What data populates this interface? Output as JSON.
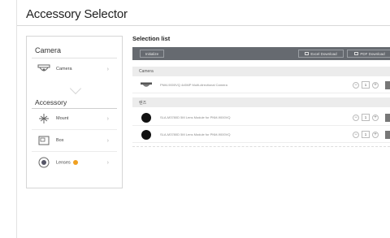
{
  "page": {
    "title": "Accessory Selector"
  },
  "left_panel": {
    "camera_section_label": "Camera",
    "camera_item": {
      "label": "Camera",
      "icon": "dome-camera-icon"
    },
    "accessory_section_label": "Accessory",
    "accessory_items": [
      {
        "label": "Mount",
        "icon": "mount-icon"
      },
      {
        "label": "Box",
        "icon": "box-icon"
      },
      {
        "label": "Lenses",
        "icon": "lens-icon",
        "badge": true
      }
    ]
  },
  "selection": {
    "title": "Selection list",
    "toolbar": {
      "initialize_label": "Initialize",
      "excel_label": "Excel Download",
      "pdf_label": "PDF Download"
    },
    "groups": [
      {
        "name": "Camera",
        "items": [
          {
            "desc": "PNM-9000VQ 4x5MP Multi-directional Camera",
            "qty": "1",
            "thumb": "dome-camera-icon"
          }
        ]
      },
      {
        "name": "렌즈",
        "items": [
          {
            "desc": "SLA-M3780D 5M Lens Module for PNM-9000VQ",
            "qty": "1",
            "thumb": "lens-icon"
          },
          {
            "desc": "SLA-M3780D 5M Lens Module for PNM-9000VQ",
            "qty": "1",
            "thumb": "lens-icon"
          }
        ]
      }
    ]
  },
  "colors": {
    "toolbar": "#666a70",
    "badge": "#f0a020",
    "group_row": "#ececec"
  }
}
